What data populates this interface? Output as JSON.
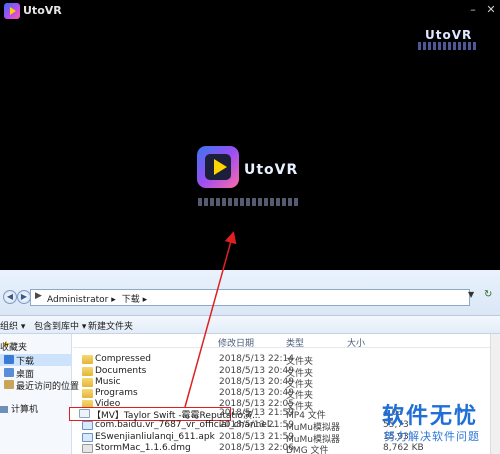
{
  "player": {
    "title": "UtoVR",
    "minimize": "–",
    "close": "✕",
    "corner_mark": "UtoVR",
    "center_brand": "UtoVR"
  },
  "explorer": {
    "nav_back": "◀",
    "nav_forward": "▶",
    "address": {
      "arrow": "▶",
      "segments": [
        "Administrator ▸",
        "下载 ▸"
      ],
      "dropdown": "▼",
      "refresh": "↻"
    },
    "toolbar": {
      "organize": "组织 ▾",
      "include_in_library": "包含到库中 ▾",
      "new_folder": "新建文件夹"
    },
    "sidebar": {
      "favorites": "收藏夹",
      "downloads": "下载",
      "desktop": "桌面",
      "recent": "最近访问的位置",
      "computer": "计算机"
    },
    "columns": {
      "date": "修改日期",
      "type": "类型",
      "size": "大小"
    },
    "rows": [
      {
        "name": "Compressed",
        "date": "2018/5/13 22:14",
        "type": "文件夹",
        "size": "",
        "icon": "folder"
      },
      {
        "name": "Documents",
        "date": "2018/5/13 20:49",
        "type": "文件夹",
        "size": "",
        "icon": "folder"
      },
      {
        "name": "Music",
        "date": "2018/5/13 20:49",
        "type": "文件夹",
        "size": "",
        "icon": "folder"
      },
      {
        "name": "Programs",
        "date": "2018/5/13 20:49",
        "type": "文件夹",
        "size": "",
        "icon": "folder"
      },
      {
        "name": "Video",
        "date": "2018/5/13 22:05",
        "type": "文件夹",
        "size": "",
        "icon": "folder"
      },
      {
        "name": "【MV】Taylor Swift -霉霉Reputatio演...",
        "date": "2018/5/13 21:59",
        "type": "MP4 文件",
        "size": "4,03",
        "icon": "file"
      },
      {
        "name": "com.baidu.vr_7687_vr_official_channel...",
        "date": "2018/5/13 21:59",
        "type": "MuMu模拟器",
        "size": "55,73",
        "icon": "apk"
      },
      {
        "name": "ESwenjianliulanqi_611.apk",
        "date": "2018/5/13 21:59",
        "type": "MuMu模拟器",
        "size": "15,93",
        "icon": "apk"
      },
      {
        "name": "StormMac_1.1.6.dmg",
        "date": "2018/5/13 22:06",
        "type": "DMG 文件",
        "size": "8,762 KB",
        "icon": "dmg"
      }
    ]
  },
  "watermark": {
    "main": "软件无忧",
    "sub": "努力解决软件问题"
  },
  "colors": {
    "highlight_box": "#e02020",
    "arrow": "#e02020",
    "watermark": "#1f6fd6"
  }
}
